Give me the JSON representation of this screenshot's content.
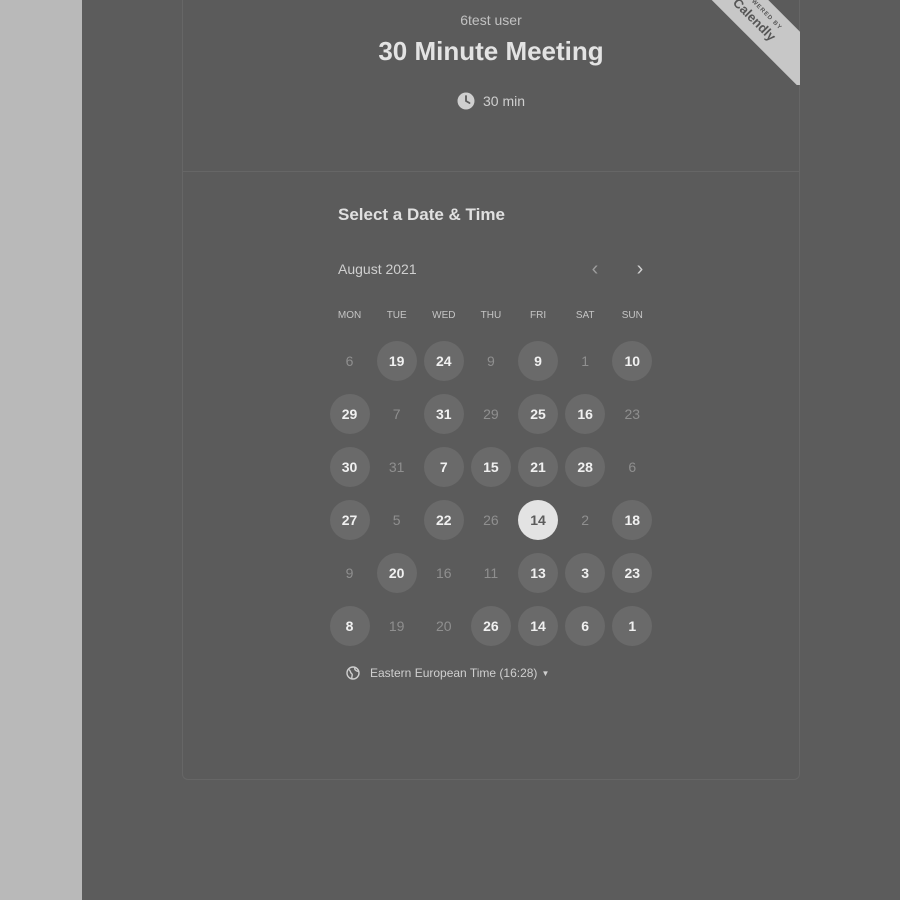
{
  "event": {
    "host": "6test user",
    "title": "30 Minute Meeting",
    "duration": "30 min"
  },
  "badge": {
    "small": "POWERED BY",
    "brand": "Calendly"
  },
  "calendar": {
    "section_title": "Select a Date & Time",
    "month": "August 2021",
    "weekdays": [
      "MON",
      "TUE",
      "WED",
      "THU",
      "FRI",
      "SAT",
      "SUN"
    ],
    "weeks": [
      [
        {
          "d": "6",
          "s": "off"
        },
        {
          "d": "19",
          "s": "avail"
        },
        {
          "d": "24",
          "s": "avail"
        },
        {
          "d": "9",
          "s": "off"
        },
        {
          "d": "9",
          "s": "avail"
        },
        {
          "d": "1",
          "s": "off"
        },
        {
          "d": "10",
          "s": "avail"
        }
      ],
      [
        {
          "d": "29",
          "s": "avail"
        },
        {
          "d": "7",
          "s": "off"
        },
        {
          "d": "31",
          "s": "avail"
        },
        {
          "d": "29",
          "s": "off"
        },
        {
          "d": "25",
          "s": "avail"
        },
        {
          "d": "16",
          "s": "avail"
        },
        {
          "d": "23",
          "s": "off"
        }
      ],
      [
        {
          "d": "30",
          "s": "avail"
        },
        {
          "d": "31",
          "s": "off"
        },
        {
          "d": "7",
          "s": "avail"
        },
        {
          "d": "15",
          "s": "avail"
        },
        {
          "d": "21",
          "s": "avail"
        },
        {
          "d": "28",
          "s": "avail"
        },
        {
          "d": "6",
          "s": "off"
        }
      ],
      [
        {
          "d": "27",
          "s": "avail"
        },
        {
          "d": "5",
          "s": "off"
        },
        {
          "d": "22",
          "s": "avail"
        },
        {
          "d": "26",
          "s": "off"
        },
        {
          "d": "14",
          "s": "selected"
        },
        {
          "d": "2",
          "s": "off"
        },
        {
          "d": "18",
          "s": "avail"
        }
      ],
      [
        {
          "d": "9",
          "s": "off"
        },
        {
          "d": "20",
          "s": "avail"
        },
        {
          "d": "16",
          "s": "off"
        },
        {
          "d": "11",
          "s": "off"
        },
        {
          "d": "13",
          "s": "avail"
        },
        {
          "d": "3",
          "s": "avail"
        },
        {
          "d": "23",
          "s": "avail"
        }
      ],
      [
        {
          "d": "8",
          "s": "avail"
        },
        {
          "d": "19",
          "s": "off"
        },
        {
          "d": "20",
          "s": "off"
        },
        {
          "d": "26",
          "s": "avail"
        },
        {
          "d": "14",
          "s": "avail"
        },
        {
          "d": "6",
          "s": "avail"
        },
        {
          "d": "1",
          "s": "avail"
        }
      ]
    ],
    "prev_icon": "chevron-left-icon",
    "next_icon": "chevron-right-icon"
  },
  "timezone": {
    "label": "Eastern European Time (16:28)",
    "icon": "globe-icon"
  }
}
